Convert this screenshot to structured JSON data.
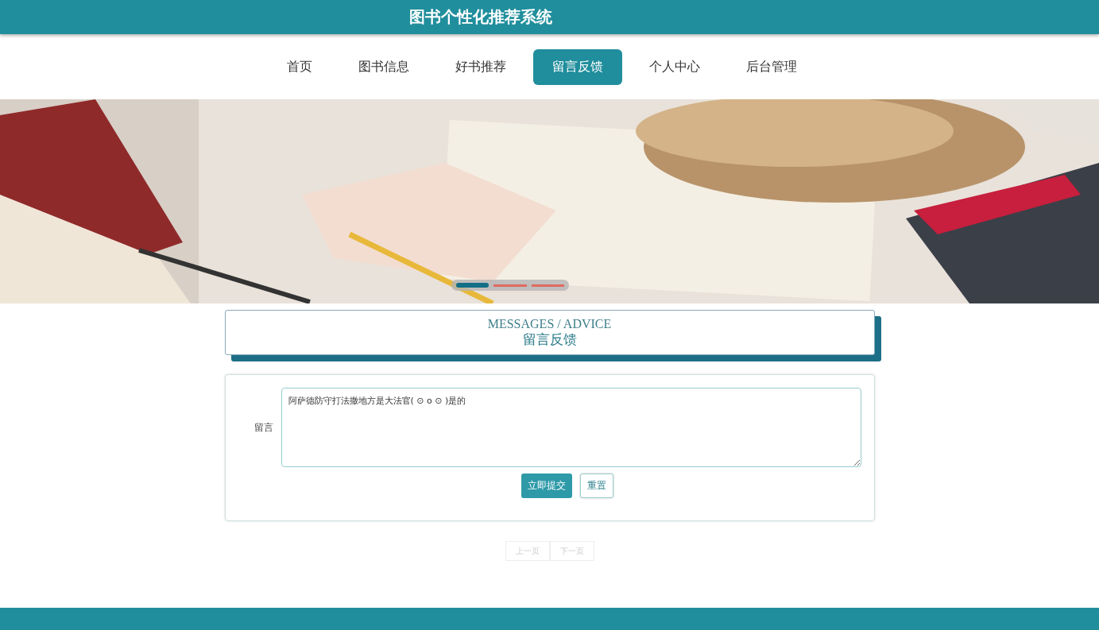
{
  "site_title": "图书个性化推荐系统",
  "nav": [
    {
      "label": "首页",
      "selected": false
    },
    {
      "label": "图书信息",
      "selected": false
    },
    {
      "label": "好书推荐",
      "selected": false
    },
    {
      "label": "留言反馈",
      "selected": true
    },
    {
      "label": "个人中心",
      "selected": false
    },
    {
      "label": "后台管理",
      "selected": false
    }
  ],
  "banner": {
    "kind": "picture",
    "indicators": [
      {
        "selected": true
      },
      {
        "selected": false
      },
      {
        "selected": false
      }
    ]
  },
  "section_header": {
    "subtitle": "MESSAGES / ADVICE",
    "title": "留言反馈"
  },
  "form": {
    "label": "留言",
    "value": "阿萨德防守打法撒地方是大法官( ⊙ o ⊙ )是的",
    "buttons": [
      {
        "label": "立即提交",
        "kind": "primary"
      },
      {
        "label": "重置",
        "kind": "plain"
      }
    ]
  },
  "pagination": [
    {
      "label": "上一页",
      "disabled": true
    },
    {
      "label": "下一页",
      "disabled": true
    }
  ]
}
